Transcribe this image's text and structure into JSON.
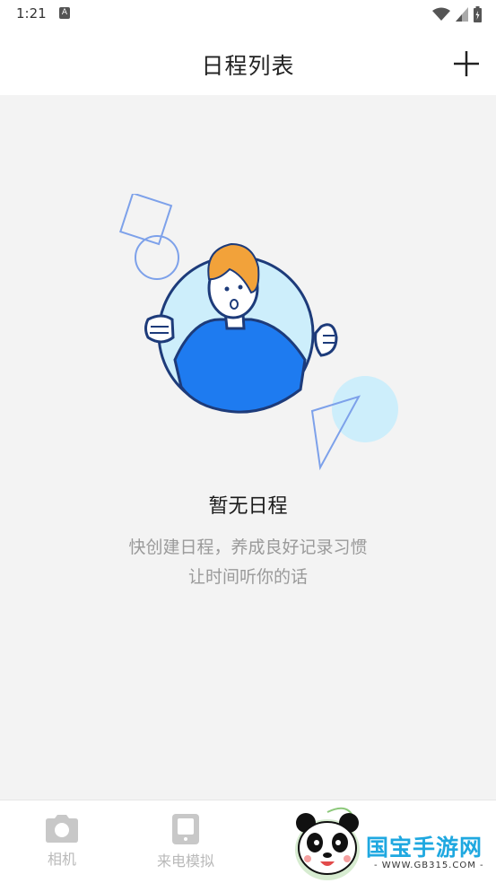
{
  "status_bar": {
    "time": "1:21",
    "notification_badge": "A"
  },
  "header": {
    "title": "日程列表",
    "add_icon": "plus-icon"
  },
  "empty_state": {
    "title": "暂无日程",
    "description_line1": "快创建日程，养成良好记录习惯",
    "description_line2": "让时间听你的话"
  },
  "bottom_nav": {
    "items": [
      {
        "label": "相机",
        "icon": "camera-icon"
      },
      {
        "label": "来电模拟",
        "icon": "phone-icon"
      }
    ]
  },
  "watermark": {
    "text": "国宝手游网",
    "url": "- WWW.GB315.COM -"
  },
  "colors": {
    "accent_blue": "#1e7bf0",
    "light_blue": "#cdeefb",
    "hair_orange": "#f2a23a",
    "background": "#f3f3f3"
  }
}
